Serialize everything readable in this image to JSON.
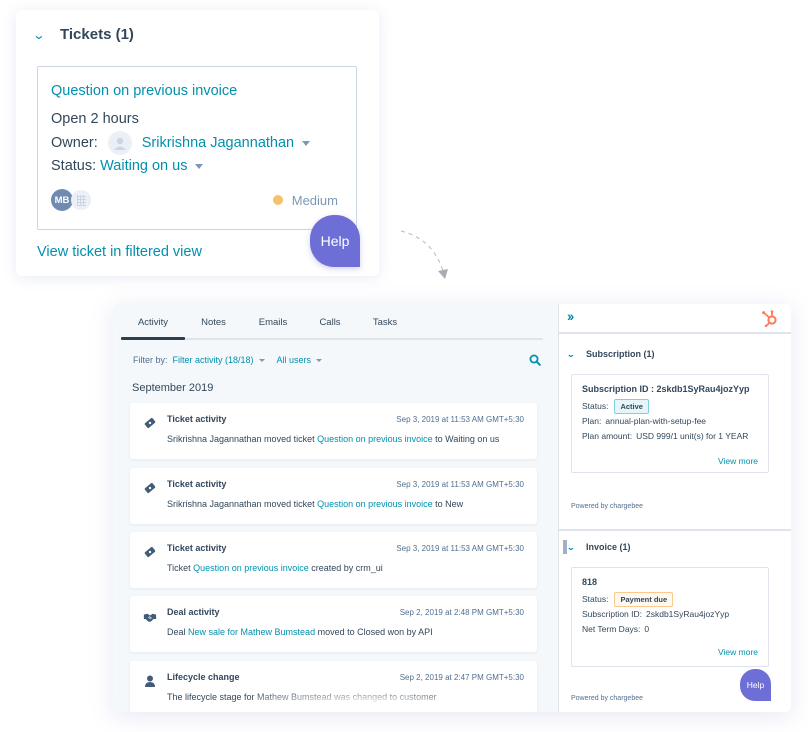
{
  "ticket_panel": {
    "section_title": "Tickets (1)",
    "ticket": {
      "name": "Question on previous invoice",
      "open_duration": "Open 2 hours",
      "owner_label": "Owner:",
      "owner_name": "Srikrishna Jagannathan",
      "status_label": "Status:",
      "status_value": "Waiting on us",
      "contact_initials": "MB",
      "priority": "Medium",
      "priority_color": "#f5c26b"
    },
    "view_link": "View ticket in filtered view",
    "help_label": "Help"
  },
  "timeline": {
    "tabs": [
      {
        "label": "Activity",
        "active": true
      },
      {
        "label": "Notes",
        "active": false
      },
      {
        "label": "Emails",
        "active": false
      },
      {
        "label": "Calls",
        "active": false
      },
      {
        "label": "Tasks",
        "active": false
      }
    ],
    "filter": {
      "label": "Filter by:",
      "activity": "Filter activity (18/18)",
      "users": "All users"
    },
    "month": "September 2019",
    "items": [
      {
        "icon": "ticket-icon",
        "type": "Ticket activity",
        "time": "Sep 3, 2019 at 11:53 AM GMT+5:30",
        "pre": "Srikrishna Jagannathan moved ticket ",
        "link": "Question on previous invoice",
        "post": " to Waiting on us"
      },
      {
        "icon": "ticket-icon",
        "type": "Ticket activity",
        "time": "Sep 3, 2019 at 11:53 AM GMT+5:30",
        "pre": "Srikrishna Jagannathan moved ticket ",
        "link": "Question on previous invoice",
        "post": " to New"
      },
      {
        "icon": "ticket-icon",
        "type": "Ticket activity",
        "time": "Sep 3, 2019 at 11:53 AM GMT+5:30",
        "pre": "Ticket ",
        "link": "Question on previous invoice",
        "post": " created by crm_ui"
      },
      {
        "icon": "handshake-icon",
        "type": "Deal activity",
        "time": "Sep 2, 2019 at 2:48 PM GMT+5:30",
        "pre": "Deal ",
        "link": "New sale for Mathew Bumstead",
        "post": " moved to Closed won by API"
      },
      {
        "icon": "person-icon",
        "type": "Lifecycle change",
        "time": "Sep 2, 2019 at 2:47 PM GMT+5:30",
        "pre": "The lifecycle stage for Mathew Bumstead was changed to customer",
        "link": "",
        "post": ""
      }
    ]
  },
  "sidebar": {
    "subscription": {
      "title": "Subscription (1)",
      "id_line": "Subscription ID : 2skdb1SyRau4jozYyp",
      "status_label": "Status:",
      "status_value": "Active",
      "plan_label": "Plan:",
      "plan_value": "annual-plan-with-setup-fee",
      "amount_label": "Plan amount:",
      "amount_value": "USD 999/1 unit(s) for 1 YEAR",
      "view_more": "View more",
      "powered_by": "Powered by chargebee"
    },
    "invoice": {
      "title": "Invoice (1)",
      "number": "818",
      "status_label": "Status:",
      "status_value": "Payment due",
      "sub_label": "Subscription ID:",
      "sub_value": "2skdb1SyRau4jozYyp",
      "net_label": "Net Term Days:",
      "net_value": "0",
      "view_more": "View more",
      "powered_by": "Powered by chargebee"
    },
    "help_label": "Help"
  },
  "colors": {
    "link": "#0091ae",
    "text": "#33475b",
    "help": "#6e6fd6",
    "hubspot": "#ff7a59"
  }
}
